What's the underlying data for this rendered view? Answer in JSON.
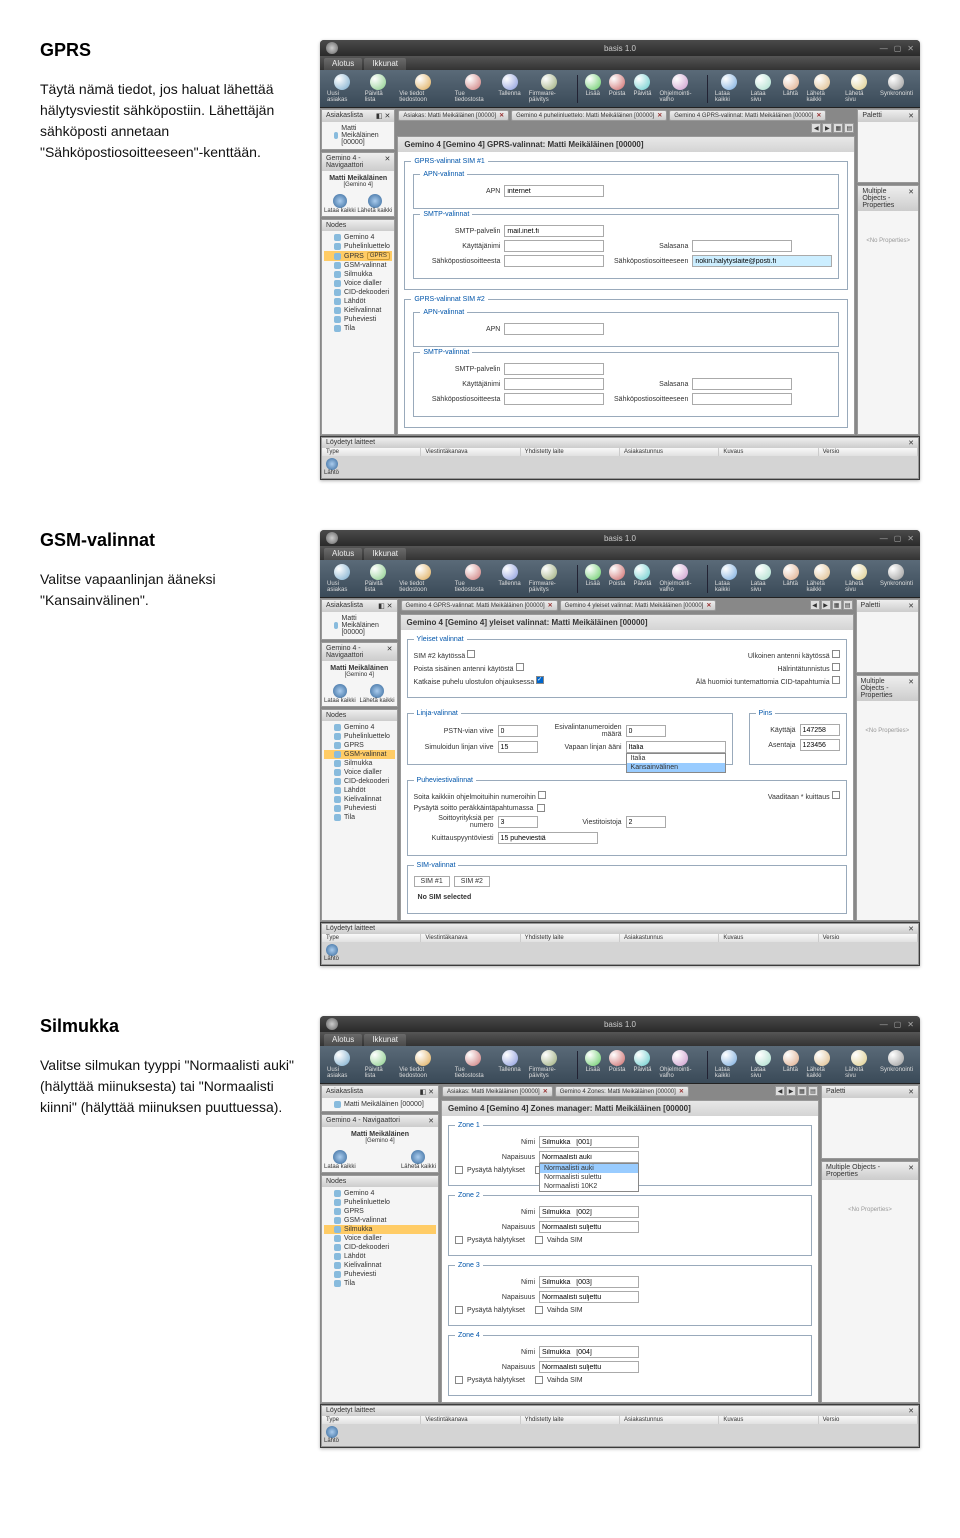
{
  "sections": {
    "gprs": {
      "heading": "GPRS",
      "body": "Täytä nämä tiedot, jos haluat lähettää hälytysviestit sähköpostiin. Lähettäjän sähköposti annetaan \"Sähköpostiosoitteeseen\"-kenttään."
    },
    "gsm": {
      "heading": "GSM-valinnat",
      "body": "Valitse vapaanlinjan ääneksi \"Kansainvälinen\"."
    },
    "silmukka": {
      "heading": "Silmukka",
      "body": "Valitse silmukan tyyppi \"Normaalisti auki\" (hälyttää miinuksesta) tai \"Normaalisti kiinni\" (hälyttää miinuksen puuttuessa)."
    }
  },
  "app": {
    "title": "basis 1.0",
    "tabs": [
      "Alotus",
      "Ikkunat"
    ],
    "toolbar": [
      {
        "label": "Uusi asiakas",
        "icon": "user"
      },
      {
        "label": "Päivitä lista",
        "icon": "refresh"
      },
      {
        "label": "Vie tiedot tiedostoon",
        "icon": "folder"
      },
      {
        "label": "Tue tiedostosta",
        "icon": "help"
      },
      {
        "label": "Tallenna",
        "icon": "save"
      },
      {
        "label": "Firmware-päivitys",
        "icon": "chip"
      },
      {
        "label": "Lisää",
        "icon": "add"
      },
      {
        "label": "Poista",
        "icon": "remove"
      },
      {
        "label": "Päivitä",
        "icon": "refresh2"
      },
      {
        "label": "Ohjelmointi-valho",
        "icon": "wizard"
      },
      {
        "label": "Lataa kaikki",
        "icon": "download"
      },
      {
        "label": "Lataa sivu",
        "icon": "page"
      },
      {
        "label": "Lähtä",
        "icon": "send"
      },
      {
        "label": "Lähetä kaikki",
        "icon": "sendall"
      },
      {
        "label": "Lähetä sivu",
        "icon": "sendpage"
      },
      {
        "label": "Synkronointi",
        "icon": "sync"
      }
    ],
    "sidebar": {
      "asiakaslista": "Asiakaslista",
      "client": "Matti Meikäläinen [00000]",
      "navigator": "Gemino 4 - Navigaattori",
      "navName": "Matti Meikäläinen",
      "navSub": "[Gemino 4]",
      "lataa": "Lataa kaikki",
      "laheta": "Lähetä kaikki",
      "nodes": "Nodes",
      "tree": [
        {
          "label": "Gemino 4"
        },
        {
          "label": "Puhelinluettelo"
        },
        {
          "label": "GPRS"
        },
        {
          "label": "GSM-valinnat"
        },
        {
          "label": "Silmukka"
        },
        {
          "label": "Voice dialler"
        },
        {
          "label": "CID-dekooderi"
        },
        {
          "label": "Lähdöt"
        },
        {
          "label": "Kielivalinnat"
        },
        {
          "label": "Puheviesti"
        },
        {
          "label": "Tila"
        }
      ]
    },
    "paletti": "Paletti",
    "properties": "Multiple Objects - Properties",
    "noProps": "<No Properties>",
    "found": {
      "title": "Löydetyt laitteet",
      "cols": [
        "Type",
        "Viestintäkanava",
        "Yhdistetty laite",
        "Asiakastunnus",
        "Kuvaus",
        "Versio"
      ],
      "btn": "Lähtö"
    }
  },
  "gprs_form": {
    "bc": [
      "Asiakas: Matti Meikäläinen [00000]",
      "Gemino 4 puhelinluettelo: Matti Meikäläinen [00000]",
      "Gemino 4 GPRS-valinnat: Matti Meikäläinen [00000]"
    ],
    "title": "Gemino 4 [Gemino 4] GPRS-valinnat: Matti Meikäläinen [00000]",
    "sim1": "GPRS-valinnat SIM #1",
    "sim2": "GPRS-valinnat SIM #2",
    "apn_section": "APN-valinnat",
    "smtp_section": "SMTP-valinnat",
    "apn_label": "APN",
    "apn_value": "internet",
    "smtp_server": "SMTP-palvelin",
    "smtp_value": "mail.inet.fi",
    "user": "Käyttäjänimi",
    "pass": "Salasana",
    "from": "Sähköpostiosoitteesta",
    "to": "Sähköpostiosoitteeseen",
    "to_value": "nokin.halytyslaite@posti.fi",
    "badge": "GPRS"
  },
  "gsm_form": {
    "bc": [
      "Gemino 4 GPRS-valinnat: Matti Meikäläinen [00000]",
      "Gemino 4 yleiset valinnat: Matti Meikäläinen [00000]"
    ],
    "title": "Gemino 4 [Gemino 4] yleiset valinnat: Matti Meikäläinen [00000]",
    "yleiset": "Yleiset valinnat",
    "sim2_use": "SIM #2 käytössä",
    "ext_ant": "Ulkoinen antenni käytössä",
    "force_int": "Poista sisäinen antenni käytöstä",
    "tamper": "Hälrintätunnistus",
    "keep_call": "Katkaise puhelu ulostulon ohjauksessa",
    "no_unknown": "Älä huomioi tuntemattomia CID-tapahtumia",
    "linja": "Linja-valinnat",
    "pins": "Pins",
    "pstn_delay": "PSTN-vian viive",
    "pstn_val": "0",
    "prenum": "Esivalintanumeroiden määrä",
    "prenum_val": "0",
    "user": "Käyttäjä",
    "user_val": "147258",
    "sim_timeout": "Simuloidun linjan viive",
    "sim_val": "15",
    "freetone": "Vapaan linjan ääni",
    "freedd": [
      "Italia",
      "Italia",
      "Kansainvälinen"
    ],
    "installer": "Asentaja",
    "installer_val": "123456",
    "puhe": "Puheviestivalinnat",
    "call_all": "Soita kaikkiin ohjelmoituihin numeroihin",
    "req_listen": "Vaaditaan * kuittaus",
    "stop_callback": "Pysäytä soitto peräkkäintäpahtumassa",
    "retry": "Soittoyrityksiä per numero",
    "retry_val": "3",
    "msgs": "Viestitoistoja",
    "msgs_val": "2",
    "conf_delay": "Kuittauspyyntöviesti",
    "conf_val": "15 puheviestiä",
    "sim_sect": "SIM-valinnat",
    "sim1": "SIM #1",
    "sim2": "SIM #2",
    "nosim": "No SIM selected"
  },
  "zones_form": {
    "bc": [
      "Asiakas: Matti Meikäläinen [00000]",
      "Gemino 4 Zones: Matti Meikäläinen [00000]"
    ],
    "title": "Gemino 4 [Gemino 4] Zones manager: Matti Meikäläinen [00000]",
    "zone": "Zone",
    "nimi": "Nimi",
    "napaisuus": "Napaisuus",
    "pysayta": "Pysäytä hälytykset",
    "vaihda": "Vaihda SIM",
    "zones": [
      {
        "n": "1",
        "nimi": "Silmukka   [001]",
        "nap": "Normaalisti auki",
        "dd": [
          "Normaalisti auki",
          "Normaalisti sulettu",
          "Normaalisti 10K2"
        ]
      },
      {
        "n": "2",
        "nimi": "Silmukka   [002]",
        "nap": "Normaalisti suljettu"
      },
      {
        "n": "3",
        "nimi": "Silmukka   [003]",
        "nap": "Normaalisti suljettu"
      },
      {
        "n": "4",
        "nimi": "Silmukka   [004]",
        "nap": "Normaalisti suljettu"
      }
    ]
  }
}
